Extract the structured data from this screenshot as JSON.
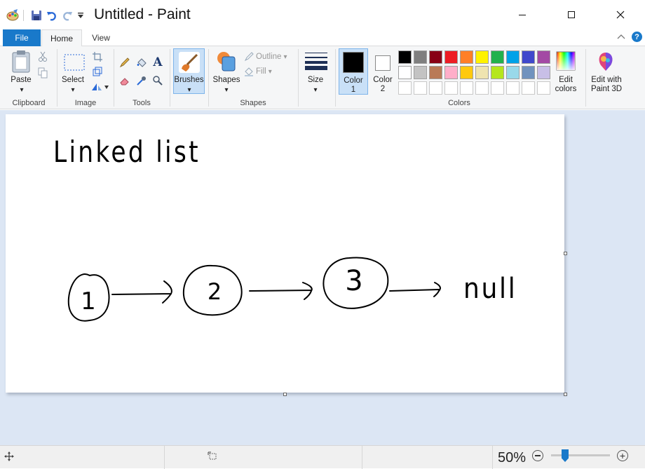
{
  "window": {
    "title": "Untitled - Paint"
  },
  "tabs": {
    "file": "File",
    "home": "Home",
    "view": "View"
  },
  "groups": {
    "clipboard": "Clipboard",
    "image": "Image",
    "tools": "Tools",
    "shapes": "Shapes",
    "colors": "Colors"
  },
  "buttons": {
    "paste": "Paste",
    "select": "Select",
    "brushes": "Brushes",
    "shapes": "Shapes",
    "outline": "Outline",
    "fill": "Fill",
    "size": "Size",
    "color1_a": "Color",
    "color1_b": "1",
    "color2_a": "Color",
    "color2_b": "2",
    "edit_colors_a": "Edit",
    "edit_colors_b": "colors",
    "paint3d_a": "Edit with",
    "paint3d_b": "Paint 3D"
  },
  "palette": {
    "row1": [
      "#000000",
      "#7f7f7f",
      "#880015",
      "#ed1c24",
      "#ff7f27",
      "#fff200",
      "#22b14c",
      "#00a2e8",
      "#3f48cc",
      "#a349a4"
    ],
    "row2": [
      "#ffffff",
      "#c3c3c3",
      "#b97a57",
      "#ffaec9",
      "#ffc90e",
      "#efe4b0",
      "#b5e61d",
      "#99d9ea",
      "#7092be",
      "#c8bfe7"
    ],
    "color1": "#000000",
    "color2": "#ffffff"
  },
  "drawing": {
    "title": "Linked list",
    "nodes": [
      "1",
      "2",
      "3"
    ],
    "terminal": "null"
  },
  "status": {
    "zoom": "50%"
  }
}
